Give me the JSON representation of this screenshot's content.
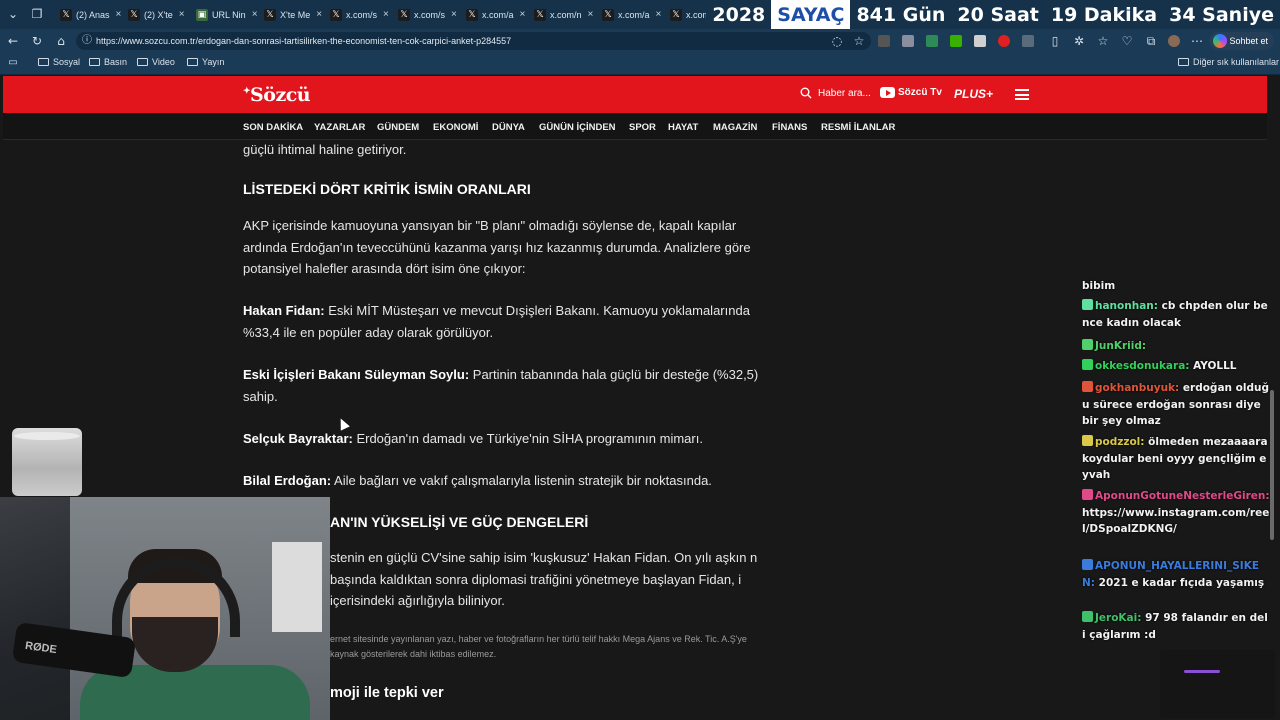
{
  "browser": {
    "tabs": [
      {
        "label": "(2) Anas",
        "icon": "x-icon"
      },
      {
        "label": "(2) X'te",
        "icon": "x-icon"
      },
      {
        "label": "URL Nin",
        "icon": "url-icon"
      },
      {
        "label": "X'te Me",
        "icon": "x-icon"
      },
      {
        "label": "x.com/s",
        "icon": "x-icon"
      },
      {
        "label": "x.com/s",
        "icon": "x-icon"
      },
      {
        "label": "x.com/a",
        "icon": "x-icon"
      },
      {
        "label": "x.com/n",
        "icon": "x-icon"
      },
      {
        "label": "x.com/a",
        "icon": "x-icon"
      },
      {
        "label": "x.com/i",
        "icon": "x-icon"
      }
    ],
    "url": "https://www.sozcu.com.tr/erdogan-dan-sonrasi-tartisilirken-the-economist-ten-cok-carpici-anket-p284557",
    "chat_button": "Sohbet et",
    "bookmarks": [
      "Sosyal",
      "Basın",
      "Video",
      "Yayın"
    ],
    "other_bookmarks": "Diğer sık kullanılanlar"
  },
  "counter": {
    "year": "2028",
    "label": "SAYAÇ",
    "days": "841 Gün",
    "hours": "20 Saat",
    "minutes": "19 Dakika",
    "seconds": "34 Saniye"
  },
  "site": {
    "logo": "Sözcü",
    "search_placeholder": "Haber ara...",
    "tv": "Sözcü Tv",
    "plus": "PLUS+",
    "nav": [
      "SON DAKİKA",
      "YAZARLAR",
      "GÜNDEM",
      "EKONOMİ",
      "DÜNYA",
      "GÜNÜN İÇİNDEN",
      "SPOR",
      "HAYAT",
      "MAGAZİN",
      "FİNANS",
      "RESMİ İLANLAR"
    ]
  },
  "article": {
    "top_fragment": "güçlü ihtimal haline getiriyor.",
    "heading1": "LİSTEDEKİ DÖRT KRİTİK İSMİN ORANLARI",
    "intro": "AKP içerisinde kamuoyuna yansıyan bir \"B planı\" olmadığı söylense de, kapalı kapılar ardında Erdoğan'ın teveccühünü kazanma yarışı hız kazanmış durumda. Analizlere göre potansiyel halefler arasında dört isim öne çıkıyor:",
    "p1_name": "Hakan Fidan:",
    "p1_text": " Eski MİT Müsteşarı ve mevcut Dışişleri Bakanı. Kamuoyu yoklamalarında %33,4 ile en popüler aday olarak görülüyor.",
    "p2_name": "Eski İçişleri Bakanı Süleyman Soylu:",
    "p2_text": " Partinin tabanında hala güçlü bir desteğe (%32,5) sahip.",
    "p3_name": "Selçuk Bayraktar:",
    "p3_text": " Erdoğan'ın damadı ve Türkiye'nin SİHA programının mimarı.",
    "p4_name": "Bilal Erdoğan:",
    "p4_text": " Aile bağları ve vakıf çalışmalarıyla listenin stratejik bir noktasında.",
    "heading2": "AN'IN YÜKSELİŞİ VE GÜÇ DENGELERİ",
    "p5": "stenin en güçlü CV'sine sahip isim 'kuşkusuz' Hakan Fidan. On yılı aşkın n başında kaldıktan sonra diplomasi trafiğini yönetmeye başlayan Fidan, i içerisindeki ağırlığıyla biliniyor.",
    "copyright": "ernet sitesinde yayınlanan yazı, haber ve fotoğrafların her türlü telif hakkı Mega Ajans ve Rek. Tic. A.Ş'ye kaynak gösterilerek dahi iktibas edilemez.",
    "react": "moji ile tepki ver"
  },
  "chat": [
    {
      "user": "",
      "text": "bibim",
      "color": "#f2f2f2"
    },
    {
      "user": "hanonhan:",
      "text": " cb chpden olur bence kadın olacak",
      "color": "#5fe0a0"
    },
    {
      "user": "JunKriid:",
      "text": " ",
      "color": "#4fd06a"
    },
    {
      "user": "okkesdonukara:",
      "text": " AYOLLL",
      "color": "#33d05a"
    },
    {
      "user": "gokhanbuyuk:",
      "text": " erdoğan olduğu sürece erdoğan sonrası diye bir şey olmaz",
      "color": "#e0553a"
    },
    {
      "user": "podzzol:",
      "text": " ölmeden mezaaaara koydular beni oyyy gençliğim eyvah",
      "color": "#d9c84a"
    },
    {
      "user": "AponunGotuneNesterleGiren:",
      "text": " https://www.instagram.com/reel/DSpoalZDKNG/",
      "color": "#e04a8a"
    },
    {
      "user": "APONUN_HAYALLERINI_SIKEN:",
      "text": " 2021 e kadar fıçıda yaşamış",
      "color": "#3a7bdc"
    },
    {
      "user": "JeroKai:",
      "text": " 97 98 falandır en deli çağlarım :d",
      "color": "#3fc06a"
    }
  ],
  "webcam": {
    "mic_brand": "RØDE"
  }
}
